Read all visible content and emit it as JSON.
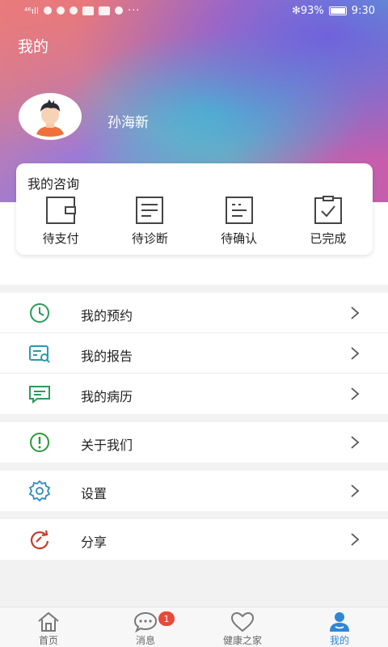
{
  "status_bar": {
    "signal": "⁴⁶ıll",
    "right_status": "✻93%",
    "time": "9:30"
  },
  "header": {
    "title": "我的"
  },
  "user": {
    "name": "孙海新"
  },
  "consult": {
    "title": "我的咨询",
    "items": [
      {
        "label": "待支付",
        "icon": "wallet-icon"
      },
      {
        "label": "待诊断",
        "icon": "document-lines-icon"
      },
      {
        "label": "待确认",
        "icon": "document-dots-icon"
      },
      {
        "label": "已完成",
        "icon": "clipboard-check-icon"
      }
    ]
  },
  "menu": {
    "appointments": {
      "label": "我的预约",
      "icon": "clock-icon"
    },
    "reports": {
      "label": "我的报告",
      "icon": "report-search-icon"
    },
    "records": {
      "label": "我的病历",
      "icon": "chat-record-icon"
    },
    "about": {
      "label": "关于我们",
      "icon": "info-exclamation-icon"
    },
    "settings": {
      "label": "设置",
      "icon": "gear-icon"
    },
    "share": {
      "label": "分享",
      "icon": "share-refresh-icon"
    }
  },
  "tabs": [
    {
      "label": "首页",
      "icon": "home-icon"
    },
    {
      "label": "消息",
      "icon": "message-icon",
      "badge": "1"
    },
    {
      "label": "健康之家",
      "icon": "heart-icon"
    },
    {
      "label": "我的",
      "icon": "person-icon",
      "active": true
    }
  ],
  "colors": {
    "accent_blue": "#2f86d6",
    "badge_red": "#e84a3a",
    "icon_green": "#2a9a5a",
    "icon_teal": "#2a9aa8",
    "icon_red": "#c83a2a"
  }
}
